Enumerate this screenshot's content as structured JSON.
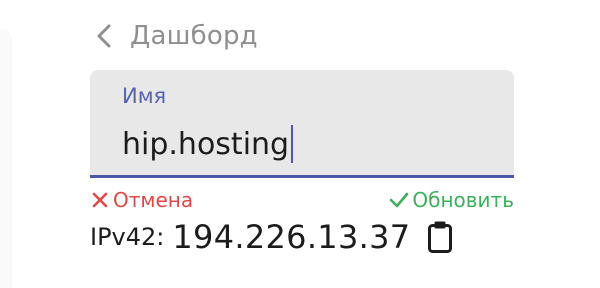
{
  "nav": {
    "back_label": "Дашборд",
    "back_icon": "chevron-left-icon"
  },
  "name_field": {
    "label": "Имя",
    "value": "hip.hosting"
  },
  "actions": {
    "cancel_label": "Отмена",
    "cancel_icon": "close-icon",
    "update_label": "Обновить",
    "update_icon": "check-icon"
  },
  "ip": {
    "label": "IPv42:",
    "value": "194.226.13.37",
    "copy_icon": "clipboard-icon"
  },
  "colors": {
    "accent": "#4a58a8",
    "label": "#5563b0",
    "cancel": "#e04848",
    "update": "#3fae5c",
    "muted": "#8f8f8f",
    "field_bg": "#e8e8e8"
  }
}
